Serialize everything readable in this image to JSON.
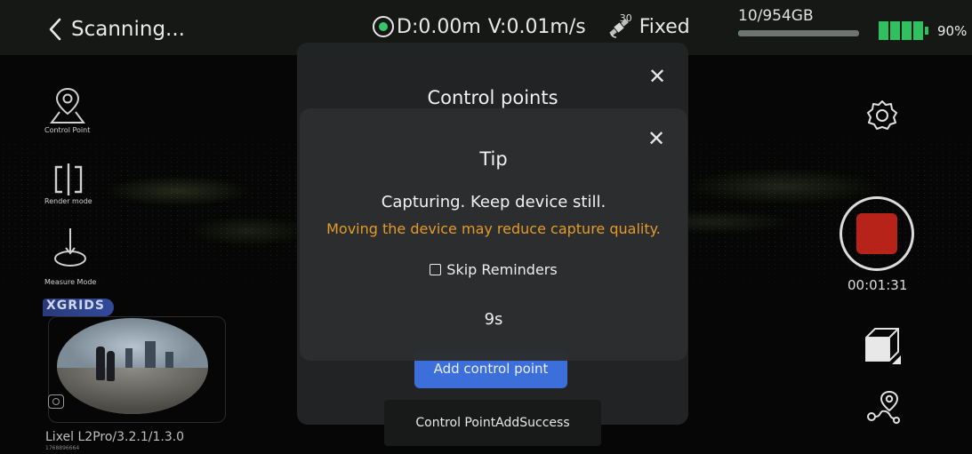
{
  "header": {
    "back_label": "Scanning...",
    "distance": "D:0.00m",
    "velocity": "V:0.01m/s",
    "satellites": "30",
    "fix_status": "Fixed",
    "storage_text": "10/954GB",
    "storage_fraction": 0.0105,
    "battery": "90%",
    "battery_level": 0.9,
    "gps_color": "#37c46a"
  },
  "left_tools": [
    {
      "label": "Control Point",
      "icon": "control-point-icon"
    },
    {
      "label": "Render mode",
      "icon": "render-mode-icon"
    },
    {
      "label": "Measure Mode",
      "icon": "measure-mode-icon"
    }
  ],
  "preview": {
    "brand": "XGRIDS",
    "device": "Lixel L2Pro/3.2.1/1.3.0",
    "serial": "1768896664"
  },
  "right_controls": {
    "settings_icon": "gear-icon",
    "record_icon": "stop-record-icon",
    "record_color": "#b72318",
    "timer": "00:01:31",
    "view_icon": "cube-view-icon",
    "route_icon": "route-pin-icon"
  },
  "control_points_dialog": {
    "title": "Control points",
    "add_button": "Add control point"
  },
  "tip_dialog": {
    "title": "Tip",
    "message": "Capturing. Keep device still.",
    "warning": "Moving the device may reduce capture quality.",
    "warning_color": "#e49b2a",
    "skip_label": "Skip Reminders",
    "skip_checked": false,
    "countdown": "9s"
  },
  "toast": "Control PointAddSuccess"
}
